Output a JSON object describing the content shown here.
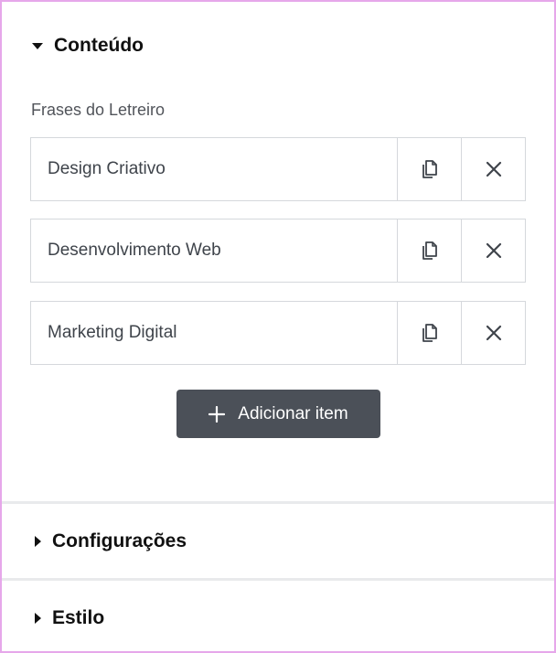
{
  "sections": {
    "content": {
      "title": "Conteúdo",
      "expanded": true
    },
    "settings": {
      "title": "Configurações",
      "expanded": false
    },
    "style": {
      "title": "Estilo",
      "expanded": false
    }
  },
  "repeater": {
    "label": "Frases do Letreiro",
    "items": [
      {
        "title": "Design Criativo"
      },
      {
        "title": "Desenvolvimento Web"
      },
      {
        "title": "Marketing Digital"
      }
    ],
    "add_label": "Adicionar item"
  },
  "colors": {
    "frame_border": "#e6a7ea",
    "button_bg": "#4b5058",
    "item_border": "#d5d8dc"
  },
  "icons": {
    "duplicate": "copy-icon",
    "remove": "close-icon",
    "add": "plus-icon",
    "expanded": "caret-down-icon",
    "collapsed": "caret-right-icon"
  }
}
